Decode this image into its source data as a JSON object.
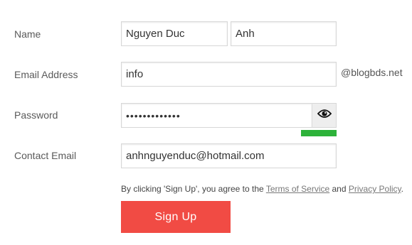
{
  "form": {
    "name": {
      "label": "Name",
      "first_value": "Nguyen Duc",
      "last_value": "Anh"
    },
    "email": {
      "label": "Email Address",
      "value": "info",
      "domain": "@blogbds.net"
    },
    "password": {
      "label": "Password",
      "value": "•••••••••••••",
      "toggle_icon": "eye-icon",
      "strength": 1.0,
      "strength_color": "#2db23a"
    },
    "contact_email": {
      "label": "Contact Email",
      "value": "anhnguyenduc@hotmail.com"
    },
    "terms": {
      "prefix": "By clicking 'Sign Up', you agree to the ",
      "tos_link": "Terms of Service",
      "middle": " and ",
      "privacy_link": "Privacy Policy",
      "suffix": "."
    },
    "submit_label": "Sign Up",
    "submit_color": "#f14b44"
  }
}
